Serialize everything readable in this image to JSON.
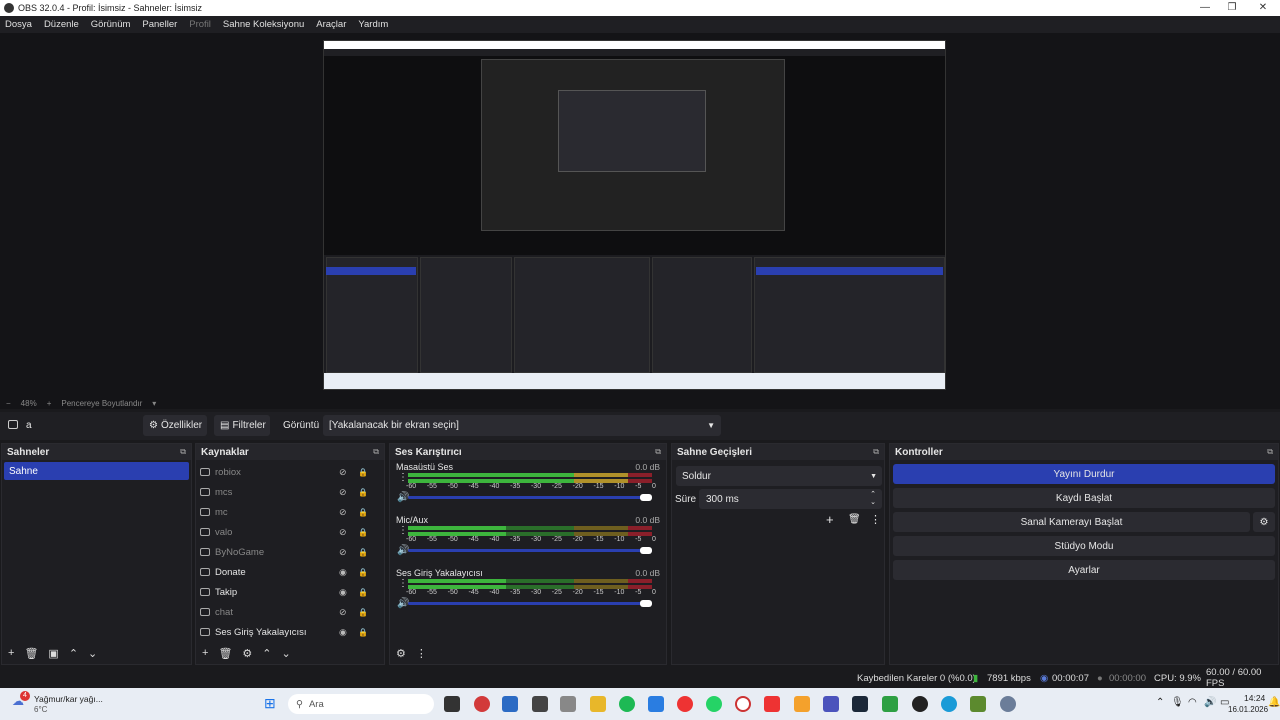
{
  "window": {
    "title": "OBS 32.0.4 - Profil: İsimsiz - Sahneler: İsimsiz"
  },
  "menu": [
    {
      "label": "Dosya",
      "dim": false
    },
    {
      "label": "Düzenle",
      "dim": false
    },
    {
      "label": "Görünüm",
      "dim": false
    },
    {
      "label": "Paneller",
      "dim": false
    },
    {
      "label": "Profil",
      "dim": true
    },
    {
      "label": "Sahne Koleksiyonu",
      "dim": false
    },
    {
      "label": "Araçlar",
      "dim": false
    },
    {
      "label": "Yardım",
      "dim": false
    }
  ],
  "zoom": {
    "minus": "−",
    "value": "48%",
    "plus": "+",
    "fit_label": "Pencereye Boyutlandır",
    "dropdown": "▾"
  },
  "toolbar": {
    "source_name": "a",
    "properties_label": "Özellikler",
    "filters_label": "Filtreler",
    "display_label": "Görüntü",
    "display_value": "[Yakalanacak bir ekran seçin]"
  },
  "scenes": {
    "title": "Sahneler",
    "items": [
      "Sahne"
    ]
  },
  "sources": {
    "title": "Kaynaklar",
    "items": [
      {
        "name": "robiox",
        "visible": false,
        "icon": "window-capture-icon"
      },
      {
        "name": "mcs",
        "visible": false,
        "icon": "window-capture-icon"
      },
      {
        "name": "mc",
        "visible": false,
        "icon": "game-capture-icon"
      },
      {
        "name": "valo",
        "visible": false,
        "icon": "game-capture-icon"
      },
      {
        "name": "ByNoGame",
        "visible": false,
        "icon": "image-icon"
      },
      {
        "name": "Donate",
        "visible": true,
        "icon": "browser-icon"
      },
      {
        "name": "Takip",
        "visible": true,
        "icon": "browser-icon"
      },
      {
        "name": "chat",
        "visible": false,
        "icon": "browser-icon"
      },
      {
        "name": "Ses Giriş Yakalayıcısı",
        "visible": true,
        "icon": "microphone-icon"
      }
    ]
  },
  "mixer": {
    "title": "Ses Karıştırıcı",
    "scale": [
      "-60",
      "-55",
      "-50",
      "-45",
      "-40",
      "-35",
      "-30",
      "-25",
      "-20",
      "-15",
      "-10",
      "-5",
      "0"
    ],
    "channels": [
      {
        "name": "Masaüstü Ses",
        "db": "0.0 dB",
        "level": 0.97
      },
      {
        "name": "Mic/Aux",
        "db": "0.0 dB",
        "level": 0.4
      },
      {
        "name": "Ses Giriş Yakalayıcısı",
        "db": "0.0 dB",
        "level": 0.4
      }
    ]
  },
  "transitions": {
    "title": "Sahne Geçişleri",
    "type": "Soldur",
    "duration_label": "Süre",
    "duration_value": "300 ms"
  },
  "controls": {
    "title": "Kontroller",
    "stop_stream": "Yayını Durdur",
    "start_record": "Kaydı Başlat",
    "start_vcam": "Sanal Kamerayı Başlat",
    "studio_mode": "Stüdyo Modu",
    "settings": "Ayarlar"
  },
  "status": {
    "dropped": "Kaybedilen Kareler 0 (%0.0)",
    "bitrate": "7891 kbps",
    "stream_time": "00:00:07",
    "rec_time": "00:00:00",
    "cpu": "CPU: 9.9%",
    "fps": "60.00 / 60.00 FPS"
  },
  "taskbar": {
    "weather_badge": "4",
    "weather": "Yağmur/kar yağı...",
    "temp": "6°C",
    "search": "Ara",
    "time": "14:24",
    "date": "16.01.2026"
  }
}
